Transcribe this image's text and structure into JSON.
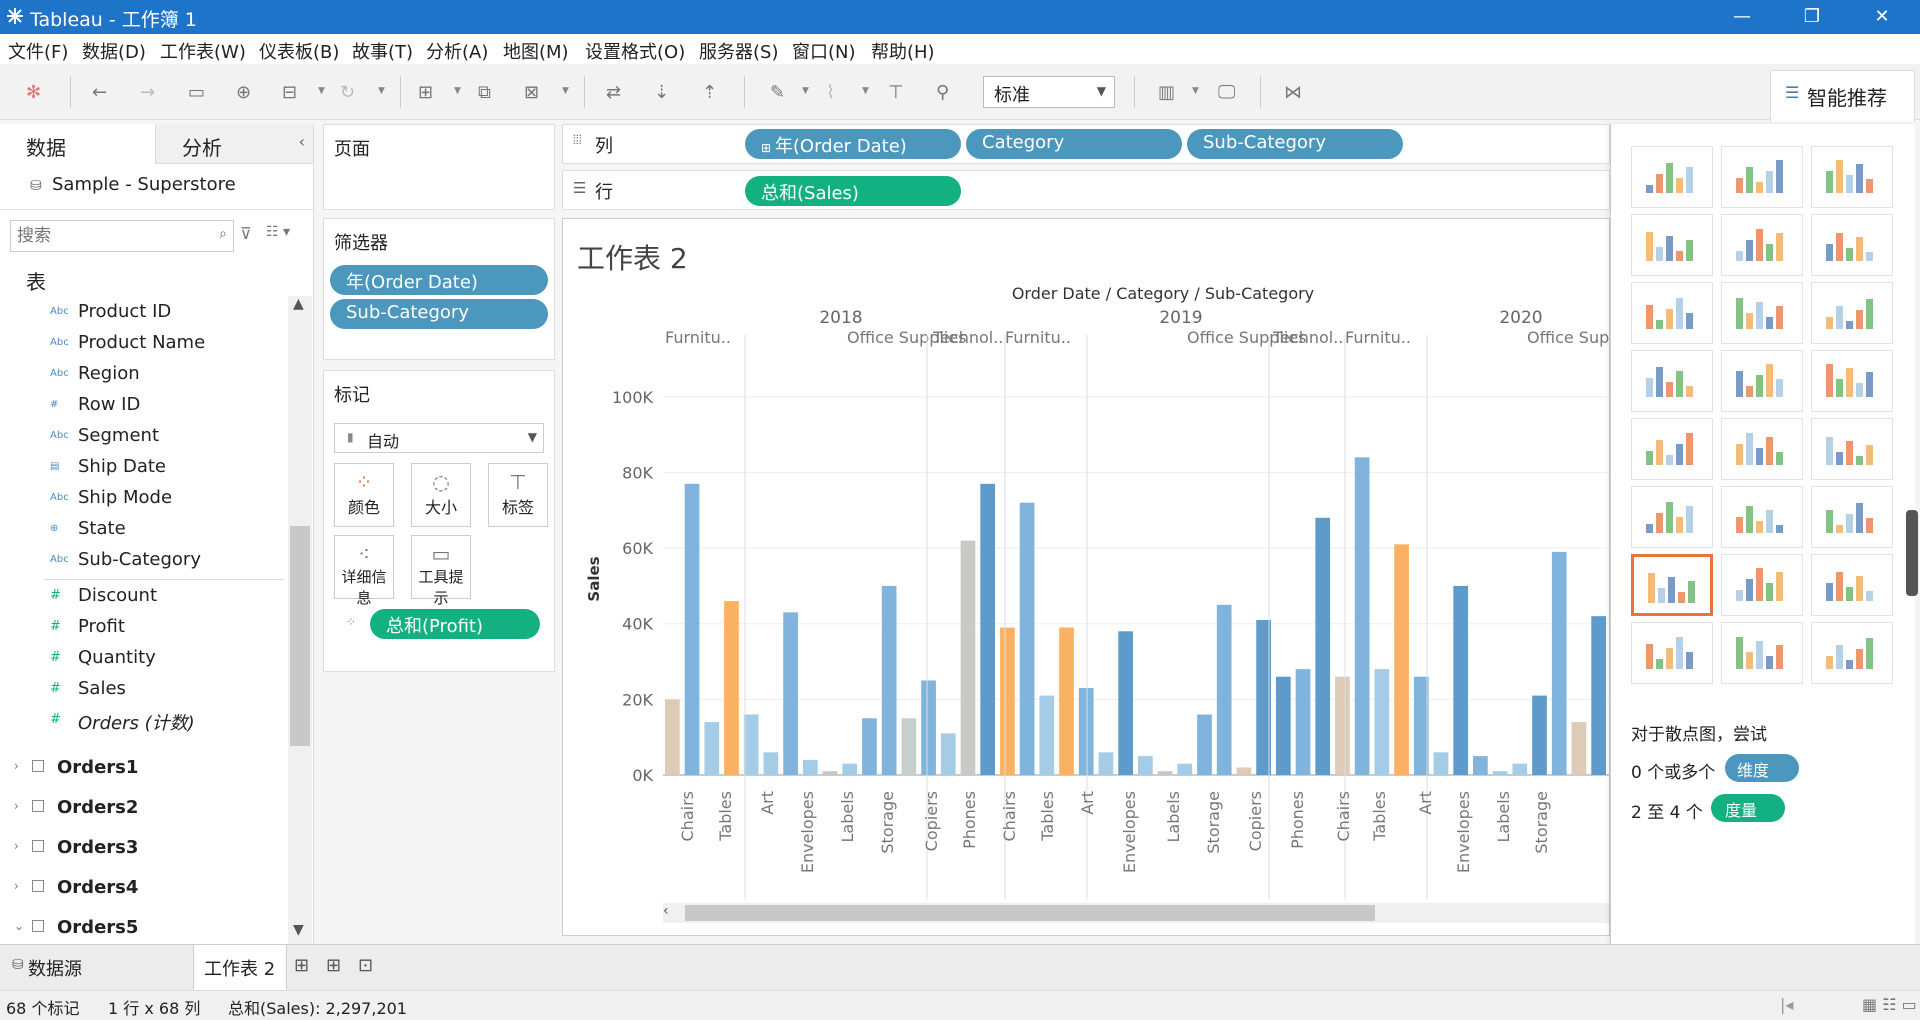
{
  "window": {
    "title": "Tableau - 工作簿 1",
    "min_icon": "minimize-icon",
    "max_icon": "restore-icon",
    "close_icon": "close-icon"
  },
  "menu": [
    "文件(F)",
    "数据(D)",
    "工作表(W)",
    "仪表板(B)",
    "故事(T)",
    "分析(A)",
    "地图(M)",
    "设置格式(O)",
    "服务器(S)",
    "窗口(N)",
    "帮助(H)"
  ],
  "toolbar": {
    "fit_label": "标准",
    "smart_label": "智能推荐"
  },
  "data_pane": {
    "tab_data": "数据",
    "tab_analysis": "分析",
    "datasource": "Sample - Superstore",
    "search_placeholder": "搜索",
    "tables_label": "表",
    "dimensions": [
      {
        "name": "Product ID",
        "type": "Abc"
      },
      {
        "name": "Product Name",
        "type": "Abc"
      },
      {
        "name": "Region",
        "type": "Abc"
      },
      {
        "name": "Row ID",
        "type": "#"
      },
      {
        "name": "Segment",
        "type": "Abc"
      },
      {
        "name": "Ship Date",
        "type": "date"
      },
      {
        "name": "Ship Mode",
        "type": "Abc"
      },
      {
        "name": "State",
        "type": "geo"
      },
      {
        "name": "Sub-Category",
        "type": "Abc"
      }
    ],
    "measures": [
      {
        "name": "Discount",
        "type": "#"
      },
      {
        "name": "Profit",
        "type": "#"
      },
      {
        "name": "Quantity",
        "type": "#"
      },
      {
        "name": "Sales",
        "type": "#"
      },
      {
        "name": "Orders (计数)",
        "type": "#"
      }
    ],
    "other_tables": [
      "Orders1",
      "Orders2",
      "Orders3",
      "Orders4",
      "Orders5"
    ]
  },
  "pages_label": "页面",
  "filters": {
    "label": "筛选器",
    "items": [
      "年(Order Date)",
      "Sub-Category"
    ]
  },
  "marks": {
    "label": "标记",
    "type": "自动",
    "buttons": [
      "颜色",
      "大小",
      "标签",
      "详细信息",
      "工具提示"
    ],
    "color_pill": "总和(Profit)"
  },
  "shelves": {
    "columns_label": "列",
    "rows_label": "行",
    "columns": [
      "年(Order Date)",
      "Category",
      "Sub-Category"
    ],
    "rows": [
      "总和(Sales)"
    ]
  },
  "sheet_title": "工作表 2",
  "chart_data": {
    "type": "bar",
    "header": "Order Date / Category / Sub-Category",
    "ylabel": "Sales",
    "ylim": [
      0,
      110000
    ],
    "yticks": [
      "0K",
      "20K",
      "40K",
      "60K",
      "80K",
      "100K"
    ],
    "ytick_values": [
      0,
      20000,
      40000,
      60000,
      80000,
      100000
    ],
    "years": [
      "2018",
      "2019",
      "2020"
    ],
    "category_labels": [
      "Furnitu..",
      "Office Supplies",
      "Technol..",
      "Furnitu..",
      "Office Supplies",
      "Technol..",
      "Furnitu..",
      "Office Supplies"
    ],
    "tick_labels": [
      "Chairs",
      "Tables",
      "Art",
      "Envelopes",
      "Labels",
      "Storage",
      "Copiers",
      "Phones",
      "Chairs",
      "Tables",
      "Art",
      "Envelopes",
      "Labels",
      "Storage",
      "Copiers",
      "Phones",
      "Chairs",
      "Tables",
      "Art",
      "Envelopes",
      "Labels",
      "Storage"
    ],
    "values": [
      20000,
      77000,
      14000,
      46000,
      16000,
      6000,
      43000,
      4000,
      1000,
      3000,
      15000,
      50000,
      15000,
      25000,
      11000,
      62000,
      77000,
      39000,
      72000,
      21000,
      39000,
      23000,
      6000,
      38000,
      5000,
      1000,
      3000,
      16000,
      45000,
      2000,
      41000,
      26000,
      28000,
      68000,
      26000,
      84000,
      28000,
      61000,
      26000,
      6000,
      50000,
      5000,
      1000,
      3000,
      21000,
      59000,
      14000,
      42000
    ],
    "colors": [
      "#ddcbb6",
      "#80b4dc",
      "#a4cce6",
      "#fbb163",
      "#a4cce6",
      "#a4cce6",
      "#80b4dc",
      "#a4cce6",
      "#c6c6c6",
      "#a4cce6",
      "#80b4dc",
      "#80b4dc",
      "#c6cfcc",
      "#80b4dc",
      "#a4cce6",
      "#c9cac6",
      "#5e9bca",
      "#fbb163",
      "#80b4dc",
      "#a4cce6",
      "#fbb163",
      "#80b4dc",
      "#a4cce6",
      "#5e9bca",
      "#a4cce6",
      "#c6c6c6",
      "#a4cce6",
      "#80b4dc",
      "#80b4dc",
      "#ddcbb6",
      "#5e9bca",
      "#5e9bca",
      "#80b4dc",
      "#5e9bca",
      "#ddcbb6",
      "#80b4dc",
      "#a4cce6",
      "#fbb163",
      "#80b4dc",
      "#a4cce6",
      "#5e9bca",
      "#80b4dc",
      "#a4cce6",
      "#a4cce6",
      "#5e9bca",
      "#80b4dc",
      "#ddcbb6",
      "#5e9bca"
    ]
  },
  "show_me": {
    "hint_title": "对于散点图，尝试",
    "line1_prefix": "0 个或多个",
    "line1_pill": "维度",
    "line2_prefix": "2 至 4 个",
    "line2_pill": "度量",
    "icons": [
      "text-table-icon",
      "heat-map-icon",
      "highlight-table-icon",
      "symbol-map-icon",
      "filled-map-icon",
      "pie-chart-icon",
      "horizontal-bar-icon",
      "stacked-bar-icon",
      "side-by-side-bar-icon",
      "treemap-icon",
      "circle-view-icon",
      "side-by-side-circle-icon",
      "line-continuous-icon",
      "line-discrete-icon",
      "dual-line-icon",
      "area-continuous-icon",
      "area-discrete-icon",
      "dual-combination-icon",
      "scatter-plot-icon",
      "histogram-icon",
      "box-whisker-icon",
      "gantt-chart-icon",
      "bullet-graph-icon",
      "packed-bubbles-icon"
    ]
  },
  "tabs": {
    "datasource": "数据源",
    "sheet": "工作表 2"
  },
  "status": {
    "marks": "68 个标记",
    "dims": "1 行 x 68 列",
    "sum": "总和(Sales): 2,297,201"
  }
}
